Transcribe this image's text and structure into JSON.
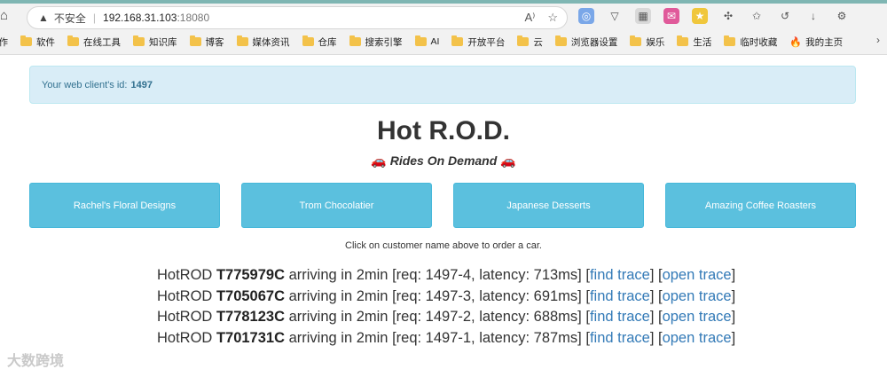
{
  "browser": {
    "insecure_label": "不安全",
    "separator": "|",
    "host": "192.168.31.103",
    "port": ":18080",
    "reader_icon": "A⁾",
    "bookmarks": [
      {
        "label": "工作",
        "kind": "folder"
      },
      {
        "label": "软件",
        "kind": "folder"
      },
      {
        "label": "在线工具",
        "kind": "folder"
      },
      {
        "label": "知识库",
        "kind": "folder"
      },
      {
        "label": "博客",
        "kind": "folder"
      },
      {
        "label": "媒体资讯",
        "kind": "folder"
      },
      {
        "label": "仓库",
        "kind": "folder"
      },
      {
        "label": "搜索引擎",
        "kind": "folder"
      },
      {
        "label": "AI",
        "kind": "folder"
      },
      {
        "label": "开放平台",
        "kind": "folder"
      },
      {
        "label": "云",
        "kind": "folder"
      },
      {
        "label": "浏览器设置",
        "kind": "folder"
      },
      {
        "label": "娱乐",
        "kind": "folder"
      },
      {
        "label": "生活",
        "kind": "folder"
      },
      {
        "label": "临时收藏",
        "kind": "folder"
      },
      {
        "label": "我的主页",
        "kind": "fire"
      }
    ]
  },
  "alert": {
    "text": "Your web client's id:",
    "client_id": "1497"
  },
  "header": {
    "title": "Hot R.O.D.",
    "subtitle": "Rides On Demand",
    "car_glyph": "🚗"
  },
  "customers": [
    {
      "label": "Rachel's Floral Designs"
    },
    {
      "label": "Trom Chocolatier"
    },
    {
      "label": "Japanese Desserts"
    },
    {
      "label": "Amazing Coffee Roasters"
    }
  ],
  "hint": "Click on customer name above to order a car.",
  "rides": [
    {
      "prefix": "HotROD",
      "car": "T775979C",
      "eta": "arriving in 2min",
      "req": "[req: 1497-4, latency: 713ms]",
      "find": "find trace",
      "open": "open trace"
    },
    {
      "prefix": "HotROD",
      "car": "T705067C",
      "eta": "arriving in 2min",
      "req": "[req: 1497-3, latency: 691ms]",
      "find": "find trace",
      "open": "open trace"
    },
    {
      "prefix": "HotROD",
      "car": "T778123C",
      "eta": "arriving in 2min",
      "req": "[req: 1497-2, latency: 688ms]",
      "find": "find trace",
      "open": "open trace"
    },
    {
      "prefix": "HotROD",
      "car": "T701731C",
      "eta": "arriving in 2min",
      "req": "[req: 1497-1, latency: 787ms]",
      "find": "find trace",
      "open": "open trace"
    }
  ],
  "watermark": "大数跨境"
}
